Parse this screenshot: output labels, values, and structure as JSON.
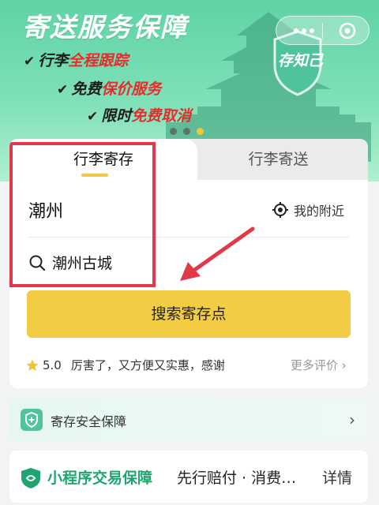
{
  "banner": {
    "title": "寄送服务保障",
    "features": [
      {
        "prefix": "行李",
        "highlight": "全程跟踪",
        "suffix": ""
      },
      {
        "prefix": "免费",
        "highlight": "保价服务",
        "suffix": ""
      },
      {
        "prefix": "限时",
        "highlight": "免费取消",
        "suffix": ""
      }
    ],
    "badge_text": "存知己",
    "carousel_count": 3,
    "carousel_active": 3
  },
  "capsule": {
    "more_icon": "more-dots-icon",
    "close_icon": "target-close-icon"
  },
  "tabs": [
    {
      "label": "行李寄存",
      "active": true
    },
    {
      "label": "行李寄送",
      "active": false
    }
  ],
  "form": {
    "city": "潮州",
    "nearby_label": "我的附近",
    "search_value": "潮州古城",
    "search_button": "搜索寄存点"
  },
  "rating": {
    "score": "5.0",
    "comment": "厉害了，又方便又实惠，感谢",
    "more_label": "更多评价",
    "more_chevron": "›"
  },
  "safety": {
    "label": "寄存安全保障",
    "chevron": "›"
  },
  "guarantee": {
    "title": "小程序交易保障",
    "desc": "先行赔付 · 消费…",
    "detail": "详情"
  },
  "colors": {
    "accent_yellow": "#f2cd44",
    "banner_green": "#5fd3a5",
    "highlight_red": "#e52d2d",
    "annotation_red": "#e03a4a",
    "guarantee_green": "#1fa56f"
  }
}
